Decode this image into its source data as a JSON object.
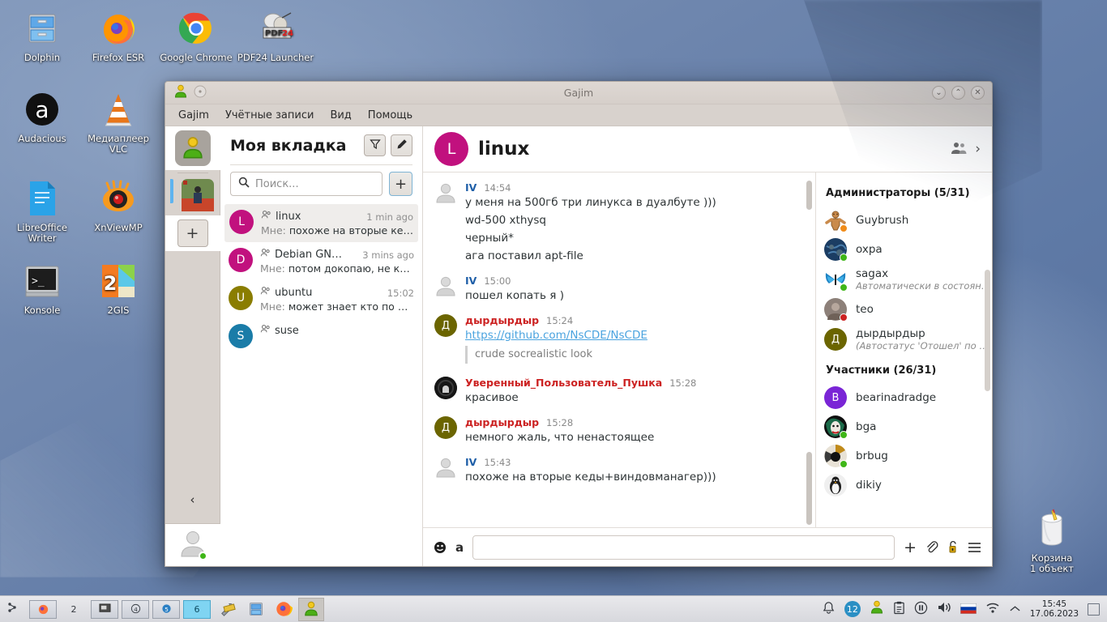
{
  "desktop": {
    "icons": [
      {
        "label": "Dolphin",
        "icon": "file-manager-icon"
      },
      {
        "label": "Firefox ESR",
        "icon": "firefox-icon"
      },
      {
        "label": "Google Chrome",
        "icon": "chrome-icon"
      },
      {
        "label": "PDF24 Launcher",
        "icon": "pdf24-icon"
      },
      {
        "label": "Audacious",
        "icon": "audacious-icon"
      },
      {
        "label": "Медиаплеер VLC",
        "icon": "vlc-icon"
      },
      {
        "label": "LibreOffice Writer",
        "icon": "writer-icon"
      },
      {
        "label": "XnViewMP",
        "icon": "xnview-icon"
      },
      {
        "label": "Konsole",
        "icon": "konsole-icon"
      },
      {
        "label": "2GIS",
        "icon": "2gis-icon"
      }
    ],
    "trash": {
      "label": "Корзина",
      "sublabel": "1 объект",
      "icon": "trash-icon"
    }
  },
  "window": {
    "title": "Gajim",
    "menu": [
      "Gajim",
      "Учётные записи",
      "Вид",
      "Помощь"
    ],
    "controls": [
      "minimize",
      "maximize",
      "close"
    ]
  },
  "rail": {
    "add_label": "+",
    "collapse_label": "‹"
  },
  "chatlist": {
    "title": "Моя вкладка",
    "filter_icon": "filter-icon",
    "edit_icon": "pencil-icon",
    "search": {
      "placeholder": "Поиск...",
      "value": "",
      "icon": "search-icon"
    },
    "add_label": "+",
    "rows": [
      {
        "initial": "L",
        "color": "#c1117e",
        "name": "linux",
        "time": "1 min ago",
        "prefix": "Мне:",
        "preview": "похоже на вторые ке…",
        "active": true
      },
      {
        "initial": "D",
        "color": "#c1117e",
        "name": "Debian GN…",
        "time": "3 mins ago",
        "prefix": "Мне:",
        "preview": "потом докопаю, не кр…",
        "active": false
      },
      {
        "initial": "U",
        "color": "#8a7d00",
        "name": "ubuntu",
        "time": "15:02",
        "prefix": "Мне:",
        "preview": "может знает кто по Д…",
        "active": false
      },
      {
        "initial": "S",
        "color": "#1a7ca8",
        "name": "suse",
        "time": "",
        "prefix": "",
        "preview": "",
        "active": false
      }
    ]
  },
  "conversation": {
    "avatar_initial": "L",
    "avatar_color": "#c1117e",
    "title": "linux",
    "members_icon": "members-icon",
    "expand_icon": "chevron-right-icon",
    "messages": [
      {
        "avatar_type": "default",
        "nick": "IV",
        "nick_color": "#1f5fa8",
        "time": "14:54",
        "lines": [
          "у меня на 500гб три линукса в дуалбуте )))",
          "wd-500 xthysq",
          "черный*",
          "ага поставил apt-file"
        ]
      },
      {
        "avatar_type": "default",
        "nick": "IV",
        "nick_color": "#1f5fa8",
        "time": "15:00",
        "lines": [
          "пошел копать я )"
        ]
      },
      {
        "avatar_type": "initial",
        "avatar_initial": "Д",
        "avatar_color": "#6b6500",
        "nick": "дырдырдыр",
        "nick_color": "#cc2222",
        "time": "15:24",
        "link": "https://github.com/NsCDE/NsCDE",
        "quote": "crude socrealistic look",
        "lines": []
      },
      {
        "avatar_type": "image-dark",
        "nick": "Уверенный_Пользователь_Пушка",
        "nick_color": "#cc2222",
        "time": "15:28",
        "lines": [
          "красивое"
        ]
      },
      {
        "avatar_type": "initial",
        "avatar_initial": "Д",
        "avatar_color": "#6b6500",
        "nick": "дырдырдыр",
        "nick_color": "#cc2222",
        "time": "15:28",
        "lines": [
          "немного жаль, что ненастоящее"
        ]
      },
      {
        "avatar_type": "default",
        "nick": "IV",
        "nick_color": "#1f5fa8",
        "time": "15:43",
        "lines": [
          "похоже на вторые кеды+виндовманагер)))"
        ]
      }
    ]
  },
  "participants": {
    "groups": [
      {
        "title": "Администраторы (5/31)",
        "members": [
          {
            "name": "Guybrush",
            "status": "",
            "presence": "#f08c1a",
            "avatar_kind": "gingerbread",
            "avatar_color": "#c98a4b",
            "initial": ""
          },
          {
            "name": "oxpa",
            "status": "",
            "presence": "#3fb618",
            "avatar_kind": "earth",
            "avatar_color": "#24476b",
            "initial": ""
          },
          {
            "name": "sagax",
            "status": "Автоматически в состоян…",
            "presence": "#3fb618",
            "avatar_kind": "butterfly",
            "avatar_color": "#1d6fa5",
            "initial": ""
          },
          {
            "name": "teo",
            "status": "",
            "presence": "#cc2222",
            "avatar_kind": "photo",
            "avatar_color": "#7d7066",
            "initial": ""
          },
          {
            "name": "дырдырдыр",
            "status": "(Автостатус 'Отошел' по …",
            "presence": "#f08c1a",
            "avatar_kind": "initial",
            "avatar_color": "#6b6500",
            "initial": "Д"
          }
        ]
      },
      {
        "title": "Участники (26/31)",
        "members": [
          {
            "name": "bearinadradge",
            "status": "",
            "presence": "#3fb618",
            "avatar_kind": "initial",
            "avatar_color": "#7a25d6",
            "initial": "B"
          },
          {
            "name": "bga",
            "status": "",
            "presence": "#3fb618",
            "avatar_kind": "joker",
            "avatar_color": "#1d6b4a",
            "initial": ""
          },
          {
            "name": "brbug",
            "status": "",
            "presence": "#3fb618",
            "avatar_kind": "vinyl",
            "avatar_color": "#b07a1a",
            "initial": ""
          },
          {
            "name": "dikiy",
            "status": "",
            "presence": "",
            "avatar_kind": "penguin",
            "avatar_color": "#dddddd",
            "initial": ""
          }
        ]
      }
    ]
  },
  "composer": {
    "emoji_icon": "emoji-icon",
    "format_icon": "format-text-icon",
    "input_value": "",
    "input_placeholder": "",
    "plus_icon": "plus-icon",
    "attach_icon": "paperclip-icon",
    "encrypt_icon": "lock-open-icon",
    "menu_icon": "hamburger-menu-icon"
  },
  "taskbar": {
    "pages": [
      {
        "label": "",
        "kind": "icon-firefox",
        "current": false
      },
      {
        "label": "2",
        "kind": "plain",
        "current": false
      },
      {
        "label": "",
        "kind": "icon-screen",
        "current": false
      },
      {
        "label": "4",
        "kind": "num-small",
        "current": false
      },
      {
        "label": "5",
        "kind": "num-blue",
        "current": false
      },
      {
        "label": "6",
        "kind": "num",
        "current": true
      }
    ],
    "apps": [
      {
        "icon": "tools-icon",
        "active": false
      },
      {
        "icon": "file-manager-icon",
        "active": false
      },
      {
        "icon": "firefox-icon",
        "active": false
      },
      {
        "icon": "gajim-icon",
        "active": true
      }
    ],
    "tray": {
      "bell_icon": "bell-icon",
      "notifications_count": "12",
      "gajim_icon": "gajim-tray-icon",
      "clipboard_icon": "clipboard-icon",
      "pause_icon": "pause-icon",
      "volume_icon": "volume-icon",
      "flag_icon": "ru-flag-icon",
      "wifi_icon": "wifi-icon",
      "expand_icon": "chevron-up-icon",
      "time": "15:45",
      "date": "17.06.2023",
      "show_desktop_icon": "show-desktop-icon"
    }
  }
}
